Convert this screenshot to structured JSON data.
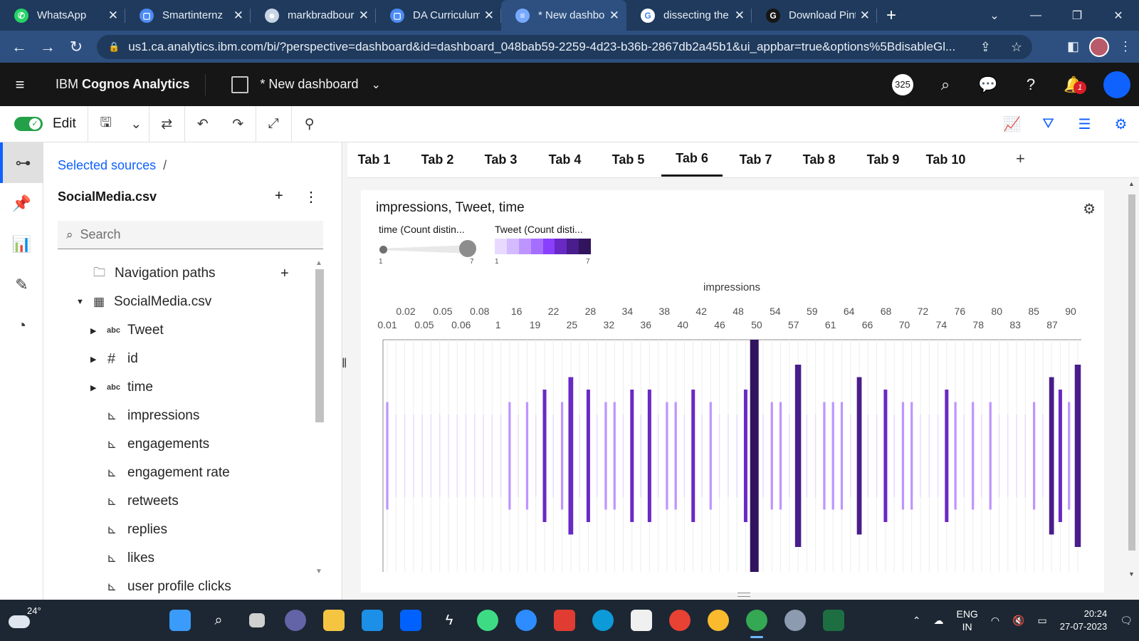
{
  "browser": {
    "tabs": [
      {
        "title": "WhatsApp",
        "color": "#25d366",
        "glyph": "✆"
      },
      {
        "title": "Smartinternz",
        "color": "#4c8bf5",
        "glyph": "▢"
      },
      {
        "title": "markbradbourn",
        "color": "#c6d4e4",
        "glyph": "☻"
      },
      {
        "title": "DA Curriculum",
        "color": "#4c8bf5",
        "glyph": "▢"
      },
      {
        "title": "* New dashboa",
        "color": "#78a9ff",
        "glyph": "≡"
      },
      {
        "title": "dissecting the",
        "color": "#ffffff",
        "glyph": "G"
      },
      {
        "title": "Download Pint",
        "color": "#161616",
        "glyph": "G"
      }
    ],
    "active_tab_index": 4,
    "url": "us1.ca.analytics.ibm.com/bi/?perspective=dashboard&id=dashboard_048bab59-2259-4d23-b36b-2867db2a45b1&ui_appbar=true&options%5BdisableGl..."
  },
  "app": {
    "brand_prefix": "IBM ",
    "brand_name": "Cognos Analytics",
    "dashboard_title": "* New dashboard",
    "bubble_text": "325",
    "notification_count": "1"
  },
  "toolbar": {
    "edit_label": "Edit"
  },
  "panel": {
    "breadcrumb_link": "Selected sources",
    "breadcrumb_sep": "/",
    "source_name": "SocialMedia.csv",
    "search_placeholder": "Search",
    "nav_paths_label": "Navigation paths",
    "table_label": "SocialMedia.csv",
    "items": [
      {
        "label": "Tweet",
        "icon": "abc",
        "expandable": true
      },
      {
        "label": "id",
        "icon": "#",
        "expandable": true
      },
      {
        "label": "time",
        "icon": "abc",
        "expandable": true
      },
      {
        "label": "impressions",
        "icon": "measure",
        "expandable": false
      },
      {
        "label": "engagements",
        "icon": "measure",
        "expandable": false
      },
      {
        "label": "engagement rate",
        "icon": "measure",
        "expandable": false
      },
      {
        "label": "retweets",
        "icon": "measure",
        "expandable": false
      },
      {
        "label": "replies",
        "icon": "measure",
        "expandable": false
      },
      {
        "label": "likes",
        "icon": "measure",
        "expandable": false
      },
      {
        "label": "user profile clicks",
        "icon": "measure",
        "expandable": false
      }
    ]
  },
  "dashboard": {
    "tabs": [
      "Tab 1",
      "Tab 2",
      "Tab 3",
      "Tab 4",
      "Tab 5",
      "Tab 6",
      "Tab 7",
      "Tab 8",
      "Tab 9",
      "Tab 10"
    ],
    "active_tab": "Tab 6",
    "add_tab": "+"
  },
  "widget": {
    "title": "impressions, Tweet, time",
    "legend_size_title": "time (Count distin...",
    "legend_size_min": "1",
    "legend_size_max": "7",
    "legend_color_title": "Tweet (Count disti...",
    "legend_color_min": "1",
    "legend_color_max": "7",
    "legend_ramp": [
      "#e8daff",
      "#d4bbff",
      "#be95ff",
      "#a56eff",
      "#8a3ffc",
      "#6929c4",
      "#491d8b",
      "#31135e"
    ]
  },
  "chart_data": {
    "type": "bar",
    "title": "impressions, Tweet, time",
    "xlabel": "impressions",
    "x_ticks_row1": [
      "0.02",
      "0.05",
      "0.08",
      "16",
      "22",
      "28",
      "34",
      "38",
      "42",
      "48",
      "54",
      "59",
      "64",
      "68",
      "72",
      "76",
      "80",
      "85",
      "90"
    ],
    "x_ticks_row2": [
      "0.01",
      "0.05",
      "0.06",
      "1",
      "19",
      "25",
      "32",
      "36",
      "40",
      "46",
      "50",
      "57",
      "61",
      "66",
      "70",
      "74",
      "78",
      "83",
      "87"
    ],
    "size_encoding": "time (Count distinct)",
    "color_encoding": "Tweet (Count distinct)",
    "size_range": [
      1,
      7
    ],
    "color_range": [
      1,
      7
    ],
    "bars": [
      {
        "t": 2,
        "c": 3
      },
      {
        "t": 1,
        "c": 1
      },
      {
        "t": 1,
        "c": 1
      },
      {
        "t": 1,
        "c": 1
      },
      {
        "t": 1,
        "c": 1
      },
      {
        "t": 1,
        "c": 1
      },
      {
        "t": 1,
        "c": 1
      },
      {
        "t": 1,
        "c": 1
      },
      {
        "t": 1,
        "c": 1
      },
      {
        "t": 1,
        "c": 1
      },
      {
        "t": 1,
        "c": 1
      },
      {
        "t": 1,
        "c": 1
      },
      {
        "t": 1,
        "c": 1
      },
      {
        "t": 1,
        "c": 1
      },
      {
        "t": 2,
        "c": 3
      },
      {
        "t": 1,
        "c": 1
      },
      {
        "t": 2,
        "c": 3
      },
      {
        "t": 1,
        "c": 1
      },
      {
        "t": 3,
        "c": 5
      },
      {
        "t": 1,
        "c": 1
      },
      {
        "t": 2,
        "c": 3
      },
      {
        "t": 4,
        "c": 5
      },
      {
        "t": 1,
        "c": 1
      },
      {
        "t": 3,
        "c": 5
      },
      {
        "t": 1,
        "c": 1
      },
      {
        "t": 2,
        "c": 3
      },
      {
        "t": 2,
        "c": 3
      },
      {
        "t": 1,
        "c": 1
      },
      {
        "t": 3,
        "c": 5
      },
      {
        "t": 1,
        "c": 1
      },
      {
        "t": 3,
        "c": 5
      },
      {
        "t": 1,
        "c": 1
      },
      {
        "t": 2,
        "c": 3
      },
      {
        "t": 2,
        "c": 3
      },
      {
        "t": 1,
        "c": 1
      },
      {
        "t": 3,
        "c": 5
      },
      {
        "t": 1,
        "c": 1
      },
      {
        "t": 2,
        "c": 3
      },
      {
        "t": 1,
        "c": 1
      },
      {
        "t": 1,
        "c": 1
      },
      {
        "t": 1,
        "c": 1
      },
      {
        "t": 3,
        "c": 5
      },
      {
        "t": 7,
        "c": 7
      },
      {
        "t": 1,
        "c": 1
      },
      {
        "t": 2,
        "c": 3
      },
      {
        "t": 2,
        "c": 3
      },
      {
        "t": 1,
        "c": 1
      },
      {
        "t": 5,
        "c": 6
      },
      {
        "t": 1,
        "c": 1
      },
      {
        "t": 1,
        "c": 1
      },
      {
        "t": 2,
        "c": 3
      },
      {
        "t": 2,
        "c": 3
      },
      {
        "t": 2,
        "c": 3
      },
      {
        "t": 1,
        "c": 1
      },
      {
        "t": 4,
        "c": 6
      },
      {
        "t": 1,
        "c": 1
      },
      {
        "t": 1,
        "c": 1
      },
      {
        "t": 3,
        "c": 5
      },
      {
        "t": 1,
        "c": 1
      },
      {
        "t": 2,
        "c": 3
      },
      {
        "t": 2,
        "c": 3
      },
      {
        "t": 1,
        "c": 1
      },
      {
        "t": 1,
        "c": 1
      },
      {
        "t": 1,
        "c": 1
      },
      {
        "t": 3,
        "c": 5
      },
      {
        "t": 2,
        "c": 3
      },
      {
        "t": 1,
        "c": 1
      },
      {
        "t": 2,
        "c": 3
      },
      {
        "t": 1,
        "c": 1
      },
      {
        "t": 2,
        "c": 3
      },
      {
        "t": 1,
        "c": 1
      },
      {
        "t": 1,
        "c": 1
      },
      {
        "t": 1,
        "c": 1
      },
      {
        "t": 1,
        "c": 1
      },
      {
        "t": 2,
        "c": 3
      },
      {
        "t": 1,
        "c": 1
      },
      {
        "t": 4,
        "c": 6
      },
      {
        "t": 3,
        "c": 5
      },
      {
        "t": 2,
        "c": 3
      },
      {
        "t": 5,
        "c": 6
      }
    ]
  },
  "taskbar": {
    "temperature": "24°",
    "lang_line1": "ENG",
    "lang_line2": "IN",
    "time": "20:24",
    "date": "27-07-2023"
  }
}
